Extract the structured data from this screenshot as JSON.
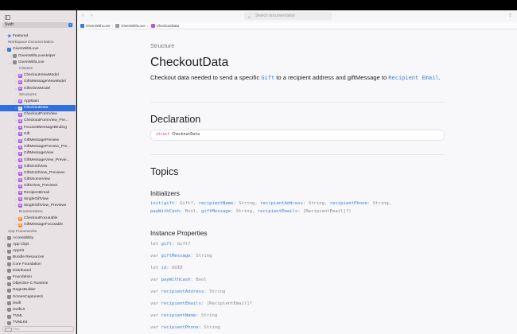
{
  "sidebar": {
    "language": "Swift",
    "filter_placeholder": "Filter",
    "items": [
      {
        "label": "Featured",
        "indent": 0,
        "icon": "star",
        "disc": ""
      },
      {
        "label": "Workspace Documentation",
        "indent": 0,
        "icon": "",
        "disc": "",
        "header": true
      },
      {
        "label": "GivenWithLove",
        "indent": 0,
        "icon": "project",
        "disc": "v"
      },
      {
        "label": "GivenWithLoveHelper",
        "indent": 1,
        "icon": "module",
        "disc": ">"
      },
      {
        "label": "GivenWithLove",
        "indent": 1,
        "icon": "module",
        "disc": "v"
      },
      {
        "label": "Classes",
        "indent": 2,
        "icon": "",
        "disc": "",
        "header": true
      },
      {
        "label": "CheckoutViewModel",
        "indent": 2,
        "icon": "C",
        "disc": ">"
      },
      {
        "label": "GiftsMessageViewModel",
        "indent": 2,
        "icon": "C",
        "disc": ">"
      },
      {
        "label": "GiftsViewModel",
        "indent": 2,
        "icon": "C",
        "disc": ">"
      },
      {
        "label": "Structures",
        "indent": 2,
        "icon": "",
        "disc": "",
        "header": true
      },
      {
        "label": "AppMain",
        "indent": 2,
        "icon": "S",
        "disc": ">"
      },
      {
        "label": "CheckoutData",
        "indent": 2,
        "icon": "S",
        "disc": ">",
        "selected": true
      },
      {
        "label": "CheckoutFormView",
        "indent": 2,
        "icon": "S",
        "disc": ">"
      },
      {
        "label": "CheckoutFormView_Pre...",
        "indent": 2,
        "icon": "S",
        "disc": ">"
      },
      {
        "label": "FocusedMessageBinding",
        "indent": 2,
        "icon": "S",
        "disc": ">"
      },
      {
        "label": "Gift",
        "indent": 2,
        "icon": "S",
        "disc": ">"
      },
      {
        "label": "GiftMessagePreview",
        "indent": 2,
        "icon": "S",
        "disc": ">"
      },
      {
        "label": "GiftMessagePreview_Pre...",
        "indent": 2,
        "icon": "S",
        "disc": ">"
      },
      {
        "label": "GiftMessageView",
        "indent": 2,
        "icon": "S",
        "disc": ">"
      },
      {
        "label": "GiftMessageView_Previe...",
        "indent": 2,
        "icon": "S",
        "disc": ">"
      },
      {
        "label": "GiftsGridView",
        "indent": 2,
        "icon": "S",
        "disc": ">"
      },
      {
        "label": "GiftsGridView_Previews",
        "indent": 2,
        "icon": "S",
        "disc": ">"
      },
      {
        "label": "GiftsHomeView",
        "indent": 2,
        "icon": "S",
        "disc": ">"
      },
      {
        "label": "GiftsView_Previews",
        "indent": 2,
        "icon": "S",
        "disc": ">"
      },
      {
        "label": "RecipientEmail",
        "indent": 2,
        "icon": "S",
        "disc": ">"
      },
      {
        "label": "SingleGiftView",
        "indent": 2,
        "icon": "S",
        "disc": ">"
      },
      {
        "label": "SingleGiftView_Previews",
        "indent": 2,
        "icon": "S",
        "disc": ">"
      },
      {
        "label": "Enumerations",
        "indent": 2,
        "icon": "",
        "disc": "",
        "header": true
      },
      {
        "label": "CheckoutFocusable",
        "indent": 2,
        "icon": "E",
        "disc": ">"
      },
      {
        "label": "GiftMessageFocusable",
        "indent": 2,
        "icon": "E",
        "disc": ">"
      },
      {
        "label": "App Frameworks",
        "indent": 0,
        "icon": "",
        "disc": "",
        "header": true
      },
      {
        "label": "Accessibility",
        "indent": 0,
        "icon": "framework",
        "disc": ">"
      },
      {
        "label": "App Clips",
        "indent": 0,
        "icon": "framework",
        "disc": ">"
      },
      {
        "label": "AppKit",
        "indent": 0,
        "icon": "framework",
        "disc": ">"
      },
      {
        "label": "Bundle Resources",
        "indent": 0,
        "icon": "framework",
        "disc": ">"
      },
      {
        "label": "Core Foundation",
        "indent": 0,
        "icon": "framework",
        "disc": ">"
      },
      {
        "label": "Distributed",
        "indent": 0,
        "icon": "framework",
        "disc": ">"
      },
      {
        "label": "Foundation",
        "indent": 0,
        "icon": "framework",
        "disc": ">"
      },
      {
        "label": "Objective-C Runtime",
        "indent": 0,
        "icon": "framework",
        "disc": ">"
      },
      {
        "label": "RegexBuilder",
        "indent": 0,
        "icon": "framework",
        "disc": ">"
      },
      {
        "label": "ScreenCaptureKit",
        "indent": 0,
        "icon": "framework",
        "disc": ">"
      },
      {
        "label": "Swift",
        "indent": 0,
        "icon": "framework",
        "disc": ">"
      },
      {
        "label": "SwiftUI",
        "indent": 0,
        "icon": "framework",
        "disc": ">"
      },
      {
        "label": "TVML",
        "indent": 0,
        "icon": "framework",
        "disc": ">"
      },
      {
        "label": "TVMLKit",
        "indent": 0,
        "icon": "framework",
        "disc": ">"
      }
    ]
  },
  "colors": {
    "class": "#a95ce0",
    "struct": "#a95ce0",
    "enum": "#f08a24",
    "selection": "#2f6fe0",
    "link": "#3a7fdc",
    "project": "#3a78e0"
  },
  "toolbar": {
    "search_placeholder": "Search documentation"
  },
  "breadcrumbs": [
    "GivenWithLove",
    "GivenWithLove",
    "CheckoutData"
  ],
  "doc": {
    "kind": "Structure",
    "title": "CheckoutData",
    "desc_pre": "Checkout data needed to send a specific ",
    "desc_link1": "Gift",
    "desc_mid": " to a recipient address and giftMessage to ",
    "desc_link2": "Recipient Email",
    "desc_post": ".",
    "declaration_heading": "Declaration",
    "declaration_kw": "struct",
    "declaration_name": "CheckoutData",
    "topics_heading": "Topics",
    "initializers_heading": "Initializers",
    "initializer_lines": [
      [
        [
          "n",
          "init("
        ],
        [
          "n",
          "gift"
        ],
        [
          "t",
          ": Gift?, "
        ],
        [
          "n",
          "recipientName"
        ],
        [
          "t",
          ": String, "
        ],
        [
          "n",
          "recipientAddress"
        ],
        [
          "t",
          ": String, "
        ],
        [
          "n",
          "recipientPhone"
        ],
        [
          "t",
          ": String,"
        ]
      ],
      [
        [
          "n",
          "payWithCash"
        ],
        [
          "t",
          ": Bool, "
        ],
        [
          "n",
          "giftMessage"
        ],
        [
          "t",
          ": String, "
        ],
        [
          "n",
          "recipientEmails"
        ],
        [
          "t",
          ": [RecipientEmail]?)"
        ]
      ]
    ],
    "properties_heading": "Instance Properties",
    "properties": [
      {
        "kw": "let",
        "name": "gift",
        "type": ": Gift?"
      },
      {
        "kw": "var",
        "name": "giftMessage",
        "type": ": String"
      },
      {
        "kw": "let",
        "name": "id",
        "type": ": UUID"
      },
      {
        "kw": "var",
        "name": "payWithCash",
        "type": ": Bool"
      },
      {
        "kw": "var",
        "name": "recipientAddress",
        "type": ": String"
      },
      {
        "kw": "var",
        "name": "recipientEmails",
        "type": ": [RecipientEmail]?"
      },
      {
        "kw": "var",
        "name": "recipientName",
        "type": ": String"
      },
      {
        "kw": "var",
        "name": "recipientPhone",
        "type": ": String"
      }
    ]
  }
}
